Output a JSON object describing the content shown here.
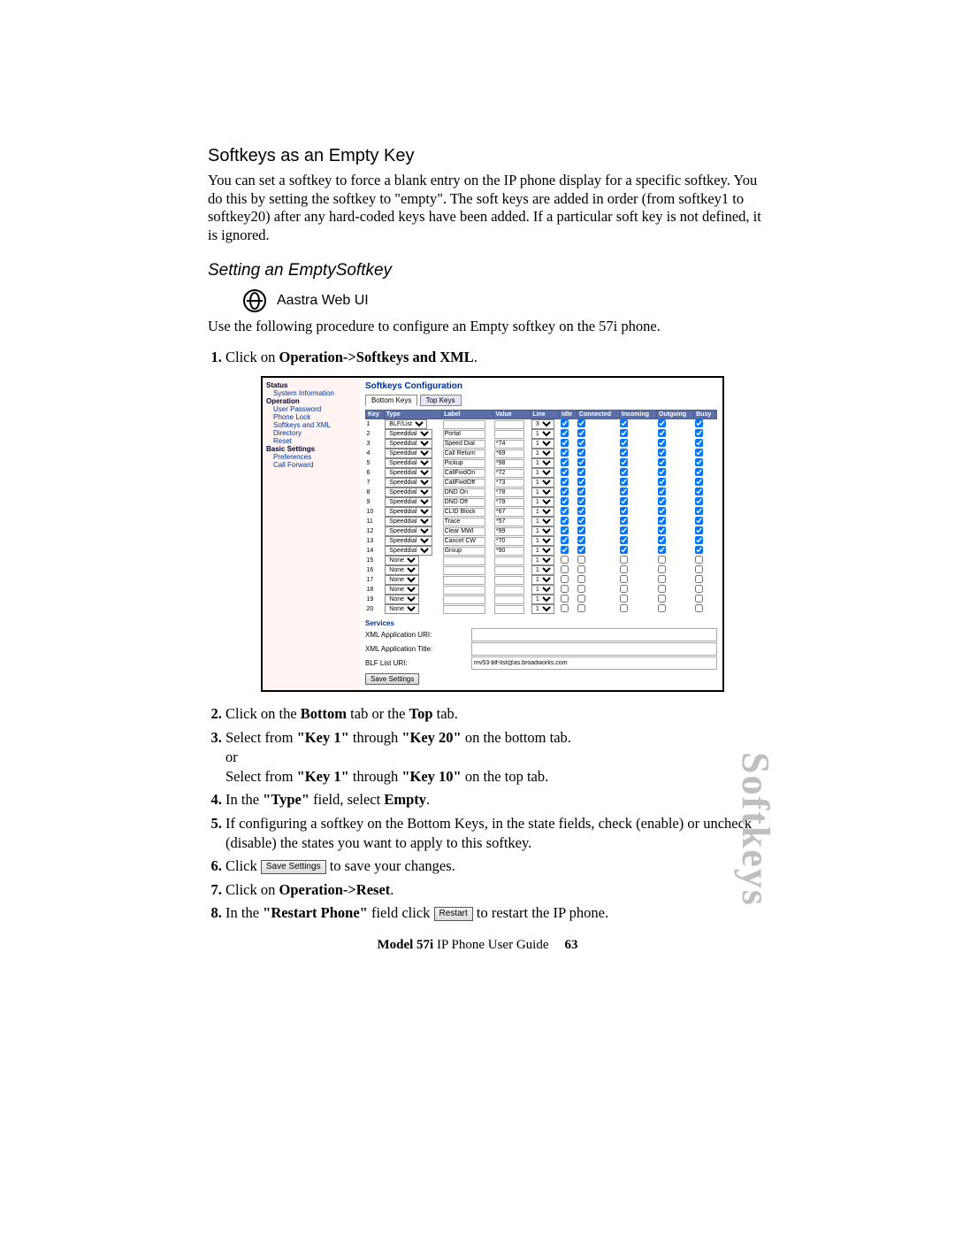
{
  "heading": "Softkeys as an Empty Key",
  "intro": "You can set a softkey to force a blank entry on the IP phone display for a specific softkey.  You do this by setting the softkey to \"empty\". The soft keys are added in order (from softkey1 to softkey20) after any hard-coded keys have been added. If a particular soft key is not defined, it is ignored.",
  "subheading": "Setting an EmptySoftkey",
  "webui_label": "Aastra Web UI",
  "intro2": "Use the following procedure to configure an Empty softkey on the 57i phone.",
  "steps": {
    "s1_a": "Click on ",
    "s1_b": "Operation->Softkeys and XML",
    "s1_c": ".",
    "s2_a": "Click on the ",
    "s2_b": "Bottom",
    "s2_c": " tab or the ",
    "s2_d": "Top",
    "s2_e": " tab.",
    "s3_a": "Select from ",
    "s3_b": "\"Key 1\"",
    "s3_c": " through ",
    "s3_d": "\"Key 20\"",
    "s3_e": " on the bottom tab.",
    "s3_or": "or",
    "s3_f": "Select from ",
    "s3_g": "\"Key 1\"",
    "s3_h": " through ",
    "s3_i": "\"Key 10\"",
    "s3_j": " on the top tab.",
    "s4_a": "In the ",
    "s4_b": "\"Type\"",
    "s4_c": " field, select ",
    "s4_d": "Empty",
    "s4_e": ".",
    "s5": "If configuring a softkey on the Bottom Keys, in the state fields, check (enable) or uncheck (disable) the states you want to apply to this softkey.",
    "s6_a": "Click ",
    "s6_btn": "Save Settings",
    "s6_b": " to save your changes.",
    "s7_a": "Click on ",
    "s7_b": "Operation->Reset",
    "s7_c": ".",
    "s8_a": "In the ",
    "s8_b": "\"Restart Phone\"",
    "s8_c": " field click ",
    "s8_btn": "Restart",
    "s8_d": " to restart the IP phone."
  },
  "figure": {
    "sidebar": {
      "status": "Status",
      "status_items": [
        "System Information"
      ],
      "operation": "Operation",
      "operation_items": [
        "User Password",
        "Phone Lock",
        "Softkeys and XML",
        "Directory",
        "Reset"
      ],
      "basic": "Basic Settings",
      "basic_items": [
        "Preferences",
        "Call Forward"
      ]
    },
    "title": "Softkeys Configuration",
    "tab_bottom": "Bottom Keys",
    "tab_top": "Top Keys",
    "headers": [
      "Key",
      "Type",
      "Label",
      "Value",
      "Line",
      "Idle",
      "Connected",
      "Incoming",
      "Outgoing",
      "Busy"
    ],
    "rows": [
      {
        "k": "1",
        "type": "BLF/List",
        "label": "",
        "value": "",
        "line": "3",
        "c": [
          true,
          true,
          true,
          true,
          true
        ]
      },
      {
        "k": "2",
        "type": "Speeddial",
        "label": "Portal",
        "value": "",
        "line": "1",
        "c": [
          true,
          true,
          true,
          true,
          true
        ]
      },
      {
        "k": "3",
        "type": "Speeddial",
        "label": "Speed Dial",
        "value": "*74",
        "line": "1",
        "c": [
          true,
          true,
          true,
          true,
          true
        ]
      },
      {
        "k": "4",
        "type": "Speeddial",
        "label": "Call Return",
        "value": "*69",
        "line": "1",
        "c": [
          true,
          true,
          true,
          true,
          true
        ]
      },
      {
        "k": "5",
        "type": "Speeddial",
        "label": "Pickup",
        "value": "*98",
        "line": "1",
        "c": [
          true,
          true,
          true,
          true,
          true
        ]
      },
      {
        "k": "6",
        "type": "Speeddial",
        "label": "CallFwdOn",
        "value": "*72",
        "line": "1",
        "c": [
          true,
          true,
          true,
          true,
          true
        ]
      },
      {
        "k": "7",
        "type": "Speeddial",
        "label": "CallFwdOff",
        "value": "*73",
        "line": "1",
        "c": [
          true,
          true,
          true,
          true,
          true
        ]
      },
      {
        "k": "8",
        "type": "Speeddial",
        "label": "DND On",
        "value": "*78",
        "line": "1",
        "c": [
          true,
          true,
          true,
          true,
          true
        ]
      },
      {
        "k": "9",
        "type": "Speeddial",
        "label": "DND Off",
        "value": "*79",
        "line": "1",
        "c": [
          true,
          true,
          true,
          true,
          true
        ]
      },
      {
        "k": "10",
        "type": "Speeddial",
        "label": "CLID Block",
        "value": "*67",
        "line": "1",
        "c": [
          true,
          true,
          true,
          true,
          true
        ]
      },
      {
        "k": "11",
        "type": "Speeddial",
        "label": "Trace",
        "value": "*57",
        "line": "1",
        "c": [
          true,
          true,
          true,
          true,
          true
        ]
      },
      {
        "k": "12",
        "type": "Speeddial",
        "label": "Clear MWI",
        "value": "*99",
        "line": "1",
        "c": [
          true,
          true,
          true,
          true,
          true
        ]
      },
      {
        "k": "13",
        "type": "Speeddial",
        "label": "Cancel CW",
        "value": "*70",
        "line": "1",
        "c": [
          true,
          true,
          true,
          true,
          true
        ]
      },
      {
        "k": "14",
        "type": "Speeddial",
        "label": "Group",
        "value": "*90",
        "line": "1",
        "c": [
          true,
          true,
          true,
          true,
          true
        ]
      },
      {
        "k": "15",
        "type": "None",
        "label": "",
        "value": "",
        "line": "1",
        "c": [
          false,
          false,
          false,
          false,
          false
        ]
      },
      {
        "k": "16",
        "type": "None",
        "label": "",
        "value": "",
        "line": "1",
        "c": [
          false,
          false,
          false,
          false,
          false
        ]
      },
      {
        "k": "17",
        "type": "None",
        "label": "",
        "value": "",
        "line": "1",
        "c": [
          false,
          false,
          false,
          false,
          false
        ]
      },
      {
        "k": "18",
        "type": "None",
        "label": "",
        "value": "",
        "line": "1",
        "c": [
          false,
          false,
          false,
          false,
          false
        ]
      },
      {
        "k": "19",
        "type": "None",
        "label": "",
        "value": "",
        "line": "1",
        "c": [
          false,
          false,
          false,
          false,
          false
        ]
      },
      {
        "k": "20",
        "type": "None",
        "label": "",
        "value": "",
        "line": "1",
        "c": [
          false,
          false,
          false,
          false,
          false
        ]
      }
    ],
    "services": {
      "header": "Services",
      "r1": "XML Application URI:",
      "r2": "XML Application Title:",
      "r3": "BLF List URI:",
      "r3v": "mv53-blf-list@as.broadworks.com",
      "save": "Save Settings"
    }
  },
  "side_tab": "Softkeys",
  "footer": {
    "model": "Model 57i",
    "rest": " IP Phone User Guide",
    "page": "63"
  }
}
